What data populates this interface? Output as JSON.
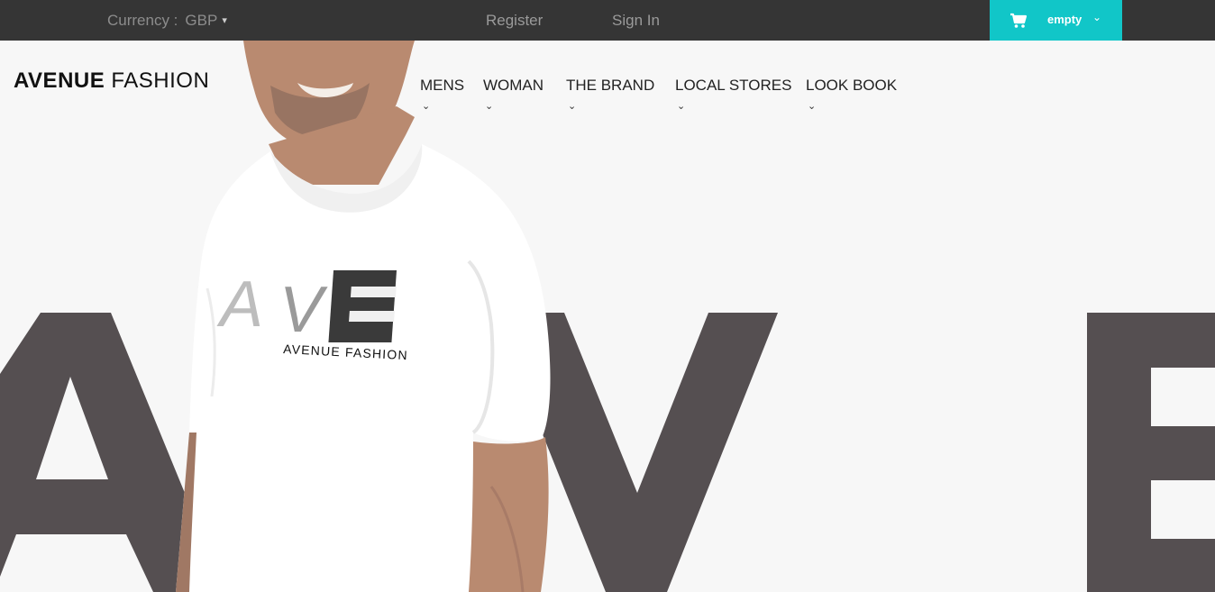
{
  "topbar": {
    "currency_label": "Currency :",
    "currency_value": "GBP",
    "currency_caret": "▾",
    "register": "Register",
    "signin": "Sign In",
    "cart_label": "empty",
    "cart_chevron": "⌄",
    "cart_icon": "shopping-cart-icon"
  },
  "header": {
    "logo_bold": "AVENUE",
    "logo_light": " FASHION"
  },
  "nav": {
    "items": [
      {
        "label": "MENS",
        "chevron": "⌄"
      },
      {
        "label": "WOMAN",
        "chevron": "⌄"
      },
      {
        "label": "THE BRAND",
        "chevron": "⌄"
      },
      {
        "label": "LOCAL STORES",
        "chevron": "⌄"
      },
      {
        "label": "LOOK BOOK",
        "chevron": "⌄"
      }
    ]
  },
  "hero": {
    "shirt_print_letters": "AVE",
    "shirt_print_text": "AVENUE FASHION"
  },
  "colors": {
    "topbar": "#353535",
    "accent": "#11c6c8",
    "letters": "#554f51",
    "background": "#f7f7f7"
  }
}
